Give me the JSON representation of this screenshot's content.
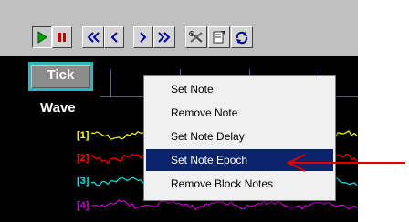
{
  "toolbar": {
    "buttons": [
      {
        "name": "play-icon",
        "pressed": true
      },
      {
        "name": "pause-icon",
        "pressed": false
      },
      {
        "name": "first-icon",
        "pressed": false
      },
      {
        "name": "previous-icon",
        "pressed": false
      },
      {
        "name": "next-icon",
        "pressed": false
      },
      {
        "name": "last-icon",
        "pressed": false
      },
      {
        "name": "tools-icon",
        "pressed": false
      },
      {
        "name": "document-icon",
        "pressed": false
      },
      {
        "name": "refresh-icon",
        "pressed": false
      }
    ]
  },
  "plot": {
    "tick_label": "Tick",
    "wave_label": "Wave",
    "channels": [
      {
        "label": "[1]",
        "color": "#ffff00"
      },
      {
        "label": "[2]",
        "color": "#ff0000"
      },
      {
        "label": "[3]",
        "color": "#00e8e8"
      },
      {
        "label": "[4]",
        "color": "#d000d0"
      }
    ]
  },
  "context_menu": {
    "items": [
      {
        "label": "Set Note",
        "highlighted": false
      },
      {
        "label": "Remove Note",
        "highlighted": false
      },
      {
        "label": "Set Note Delay",
        "highlighted": false
      },
      {
        "label": "Set Note Epoch",
        "highlighted": true
      },
      {
        "label": "Remove Block Notes",
        "highlighted": false
      }
    ]
  },
  "annotation": {
    "color": "#e00000"
  }
}
